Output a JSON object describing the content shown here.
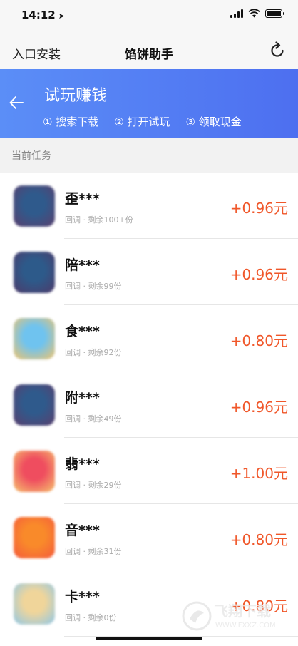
{
  "status_bar": {
    "time": "14:12",
    "location_glyph": "➤"
  },
  "nav": {
    "left_label": "入口安装",
    "title": "馅饼助手"
  },
  "banner": {
    "title": "试玩赚钱",
    "steps": [
      "① 搜索下载",
      "② 打开试玩",
      "③ 领取现金"
    ]
  },
  "section": {
    "title": "当前任务"
  },
  "tasks": [
    {
      "name": "歪***",
      "meta": "回调 · 剩余100+份",
      "reward": "+0.96元",
      "icon_color1": "#2f5a8c",
      "icon_color2": "#5a3f6e"
    },
    {
      "name": "陪***",
      "meta": "回调 · 剩余99份",
      "reward": "+0.96元",
      "icon_color1": "#2d5a8a",
      "icon_color2": "#4d3a6a"
    },
    {
      "name": "食***",
      "meta": "回调 · 剩余92份",
      "reward": "+0.80元",
      "icon_color1": "#6fc3ef",
      "icon_color2": "#f2c46b"
    },
    {
      "name": "附***",
      "meta": "回调 · 剩余49份",
      "reward": "+0.96元",
      "icon_color1": "#2f5a8c",
      "icon_color2": "#5a3f6e"
    },
    {
      "name": "翡***",
      "meta": "回调 · 剩余29份",
      "reward": "+1.00元",
      "icon_color1": "#ef4d5f",
      "icon_color2": "#f6c46e"
    },
    {
      "name": "音***",
      "meta": "回调 · 剩余31份",
      "reward": "+0.80元",
      "icon_color1": "#f98a2a",
      "icon_color2": "#f45a3c"
    },
    {
      "name": "卡***",
      "meta": "回调 · 剩余0份",
      "reward": "+0.80元",
      "icon_color1": "#f0d59a",
      "icon_color2": "#8ec7e8"
    }
  ],
  "watermark": {
    "brand": "飞翔下载",
    "url": "WWW.FXXZ.COM"
  },
  "colors": {
    "accent": "#4d6ff0",
    "reward": "#f0572a"
  }
}
